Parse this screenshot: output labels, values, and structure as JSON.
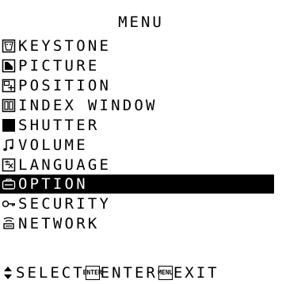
{
  "menu": {
    "title": "MENU",
    "items": [
      {
        "label": "KEYSTONE",
        "icon": "keystone-icon",
        "selected": false
      },
      {
        "label": "PICTURE",
        "icon": "picture-icon",
        "selected": false
      },
      {
        "label": "POSITION",
        "icon": "position-icon",
        "selected": false
      },
      {
        "label": "INDEX WINDOW",
        "icon": "index-window-icon",
        "selected": false
      },
      {
        "label": "SHUTTER",
        "icon": "shutter-icon",
        "selected": false
      },
      {
        "label": "VOLUME",
        "icon": "volume-icon",
        "selected": false
      },
      {
        "label": "LANGUAGE",
        "icon": "language-icon",
        "selected": false
      },
      {
        "label": "OPTION",
        "icon": "option-icon",
        "selected": true
      },
      {
        "label": "SECURITY",
        "icon": "security-icon",
        "selected": false
      },
      {
        "label": "NETWORK",
        "icon": "network-icon",
        "selected": false
      }
    ]
  },
  "footer": {
    "select_label": "SELECT",
    "enter_key": "ENTER",
    "enter_label": "ENTER",
    "menu_key": "MENU",
    "exit_label": "EXIT"
  },
  "colors": {
    "background": "#ffffff",
    "foreground": "#000000",
    "highlight": "#000000",
    "highlight_text": "#ffffff"
  }
}
